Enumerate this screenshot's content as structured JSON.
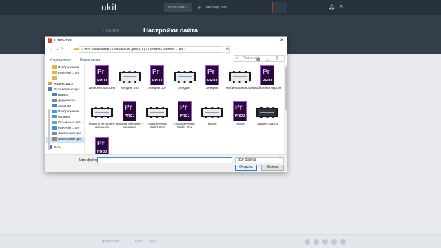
{
  "app": {
    "logo": "ukit",
    "my_sites_label": "Мои сайты",
    "add_symbol": "+",
    "domain": "ukit-help.com",
    "back_label": "НАЗАД",
    "page_title": "Настройки сайта"
  },
  "footer": {
    "language": "Русский",
    "blog": "Блог",
    "faq": "FAQ"
  },
  "dialog": {
    "title": "Открытие",
    "close_symbol": "✕",
    "breadcrumb": "›  Этот компьютер  ›  Локальный диск (D:)  ›  Проекты Premier  ›  ukit  ›",
    "search_placeholder": "Поиск: ukit",
    "organize_label": "Упорядочить ▾",
    "new_folder_label": "Новая папка",
    "sidebar": [
      {
        "label": "Изображения",
        "icon": "folder-icon"
      },
      {
        "label": "Рабочий стол",
        "icon": "folder-icon"
      },
      {
        "label": "",
        "icon": "folder-icon"
      },
      {
        "label": "Яндекс.Диск",
        "icon": "cloud-icon"
      },
      {
        "label": "Этот компьютер",
        "icon": "computer-icon"
      },
      {
        "label": "Видео",
        "icon": "video-icon"
      },
      {
        "label": "Документы",
        "icon": "documents-icon"
      },
      {
        "label": "Загрузки",
        "icon": "downloads-icon"
      },
      {
        "label": "Изображения",
        "icon": "pictures-icon"
      },
      {
        "label": "Музыка",
        "icon": "music-icon"
      },
      {
        "label": "Объемные объ",
        "icon": "3d-icon"
      },
      {
        "label": "Рабочий стол",
        "icon": "desktop-icon"
      },
      {
        "label": "Локальный дис",
        "icon": "drive-icon"
      },
      {
        "label": "Локальный дис",
        "icon": "drive-icon"
      },
      {
        "label": "Сеть",
        "icon": "network-icon"
      }
    ],
    "files": [
      {
        "name": "Интернет-магазин",
        "kind": "proj"
      },
      {
        "name": "Лендинг 2.0",
        "kind": "video"
      },
      {
        "name": "Лендинг 2.0",
        "kind": "proj"
      },
      {
        "name": "Лендинг",
        "kind": "video"
      },
      {
        "name": "Лендинг",
        "kind": "proj"
      },
      {
        "name": "Мобильная версия",
        "kind": "video"
      },
      {
        "name": "Мобильная версия",
        "kind": "proj"
      },
      {
        "name": "Модуль интернет-магазина",
        "kind": "video"
      },
      {
        "name": "Модуль интернет-магазина",
        "kind": "proj"
      },
      {
        "name": "Подключение Wallet One",
        "kind": "video"
      },
      {
        "name": "Подключение Wallet One",
        "kind": "proj"
      },
      {
        "name": "Якоря",
        "kind": "video"
      },
      {
        "name": "Якоря",
        "kind": "proj"
      },
      {
        "name": "Яндекс.Карты",
        "kind": "video-dark"
      },
      {
        "name": "",
        "kind": "proj"
      }
    ],
    "proj_letters": "Pr",
    "proj_ext": "PROJ",
    "filename_label": "Имя файла:",
    "filename_value": "",
    "filetype_value": "Все файлы",
    "open_label": "Открыть",
    "cancel_label": "Отмена"
  },
  "colors": {
    "topbar": "#28323c",
    "header": "#323e4a",
    "accent_green": "#6fd18e",
    "premiere_purple": "#9b55d4"
  }
}
